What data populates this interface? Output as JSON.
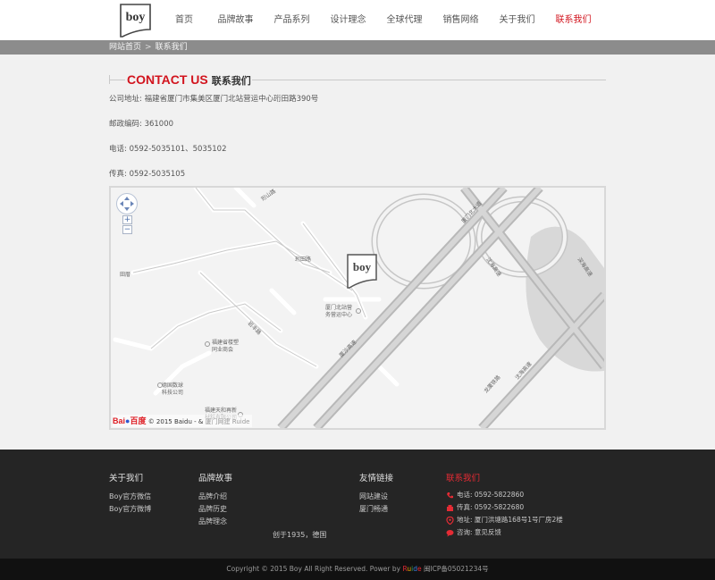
{
  "header": {
    "logo_text": "boy",
    "nav": [
      {
        "label": "首页",
        "active": false
      },
      {
        "label": "品牌故事",
        "active": false
      },
      {
        "label": "产品系列",
        "active": false
      },
      {
        "label": "设计理念",
        "active": false
      },
      {
        "label": "全球代理",
        "active": false
      },
      {
        "label": "销售网络",
        "active": false
      },
      {
        "label": "关于我们",
        "active": false
      },
      {
        "label": "联系我们",
        "active": true
      }
    ]
  },
  "breadcrumb": {
    "home": "网站首页",
    "separator": ">",
    "current": "联系我们"
  },
  "content": {
    "title_en": "CONTACT US",
    "title_cn": "联系我们",
    "address": "公司地址: 福建省厦门市集美区厦门北站营运中心珩田路390号",
    "postcode": "邮政编码: 361000",
    "phone": "电话: 0592-5035101、5035102",
    "fax": "传真: 0592-5035105"
  },
  "map": {
    "labels": {
      "road_1": "珩山路",
      "road_2": "珩田路",
      "road_3": "岩丰路",
      "place_1": "田厝",
      "place_2": "厦门北站营\n务营运中心",
      "place_3": "福建省楼塑\n同业商会",
      "place_4": "德国数球\n科技公司",
      "place_5": "福建天和再新\n材料有限公司",
      "road_4": "厦沙高速",
      "road_5": "厦门北大道",
      "road_6": "沈海高速",
      "road_7": "龙厦铁路",
      "road_8": "沈海高速",
      "road_9": "深海高速"
    },
    "zoom_in": "+",
    "zoom_out": "−",
    "copyright_prefix": "© 2015 Baidu - &",
    "copyright_suffix": "厦门网建 Ruide",
    "baidu_logo_1": "Bai",
    "baidu_logo_2": "百度"
  },
  "footer": {
    "about": {
      "title": "关于我们",
      "links": [
        "Boy官方微信",
        "Boy官方微博"
      ]
    },
    "brand": {
      "title": "品牌故事",
      "links": [
        "品牌介绍",
        "品牌历史",
        "品牌理念"
      ]
    },
    "friends": {
      "title": "友情链接",
      "links": [
        "网站建设",
        "厦门畅通"
      ]
    },
    "contact": {
      "title": "联系我们",
      "phone": "电话: 0592-5822860",
      "fax": "传真: 0592-5822680",
      "address": "地址: 厦门洪塘路168号1号厂房2楼",
      "feedback": "咨询: 意见反馈"
    },
    "founded": "创于1935，德国",
    "copyright_prefix": "Copyright © 2015 Boy All Right Reserved. Power by ",
    "copyright_brand": "Ruide",
    "copyright_suffix": " 闽ICP备05021234号"
  },
  "colors": {
    "accent_red": "#d2141e",
    "footer_bg": "#252525",
    "breadcrumb_bg": "#8c8c8c"
  }
}
